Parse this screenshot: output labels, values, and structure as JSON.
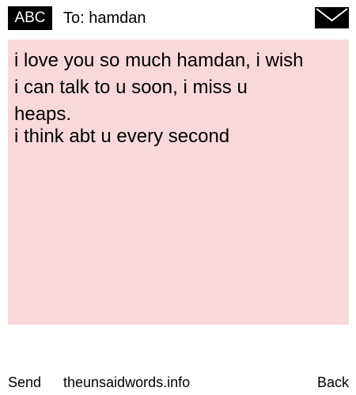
{
  "header": {
    "input_mode": "ABC",
    "recipient": "To: hamdan",
    "message_icon": "envelope-icon"
  },
  "message": {
    "lines": [
      "i love you so much hamdan, i wish",
      "i can talk to u soon, i miss u",
      "heaps.",
      "i think abt u every second"
    ],
    "background_color": "#f9d8dc"
  },
  "softkeys": {
    "left": "Send",
    "center": "theunsaidwords.info",
    "right": "Back"
  }
}
